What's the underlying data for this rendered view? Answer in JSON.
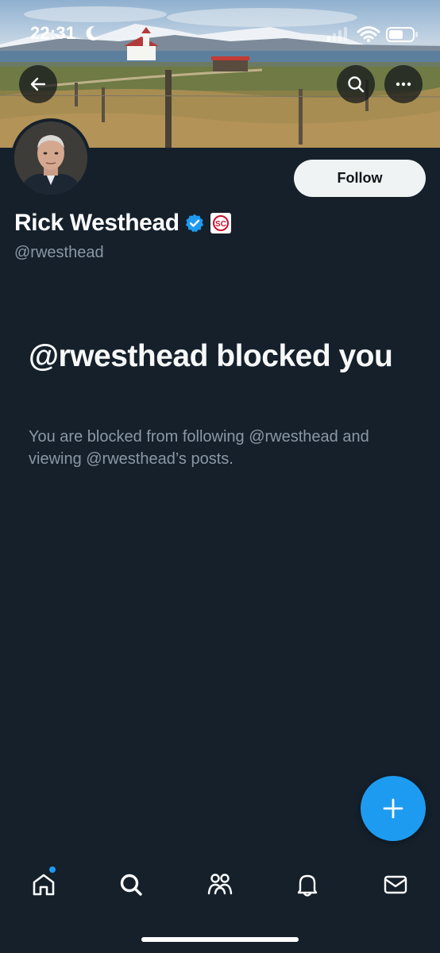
{
  "status_bar": {
    "time": "22:31"
  },
  "header": {
    "back_icon": "arrow-left-icon",
    "search_icon": "search-icon",
    "more_icon": "more-horizontal-icon"
  },
  "profile": {
    "display_name": "Rick Westhead",
    "handle": "@rwesthead",
    "verified": true,
    "affiliation_badge_icon": "sc-affiliate-badge-icon",
    "follow_label": "Follow"
  },
  "blocked": {
    "title": "@rwesthead blocked you",
    "description": "You are blocked from following @rwesthead and viewing @rwesthead’s posts."
  },
  "fab": {
    "icon": "plus-icon"
  },
  "bottom_nav": {
    "items": [
      {
        "name": "home",
        "icon": "home-icon",
        "has_notification_dot": true
      },
      {
        "name": "explore",
        "icon": "search-icon"
      },
      {
        "name": "communities",
        "icon": "communities-icon"
      },
      {
        "name": "notifications",
        "icon": "bell-icon"
      },
      {
        "name": "messages",
        "icon": "mail-icon"
      }
    ]
  },
  "colors": {
    "background": "#15202b",
    "accent": "#1d9bf0",
    "secondary_text": "#8b98a5",
    "follow_button_bg": "#eff3f4"
  }
}
